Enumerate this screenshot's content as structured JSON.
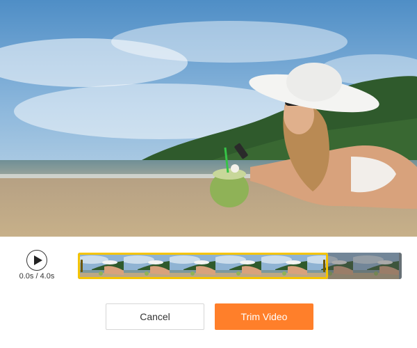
{
  "video": {
    "description_icon": "video-preview"
  },
  "player": {
    "play_icon": "play-icon",
    "time_current": "0.0s",
    "time_separator": " / ",
    "time_total": "4.0s",
    "time_label": "0.0s / 4.0s"
  },
  "timeline": {
    "frame_count": 7,
    "selection_color": "#f5c400"
  },
  "actions": {
    "cancel_label": "Cancel",
    "trim_label": "Trim Video",
    "trim_color": "#ff7f2a"
  }
}
